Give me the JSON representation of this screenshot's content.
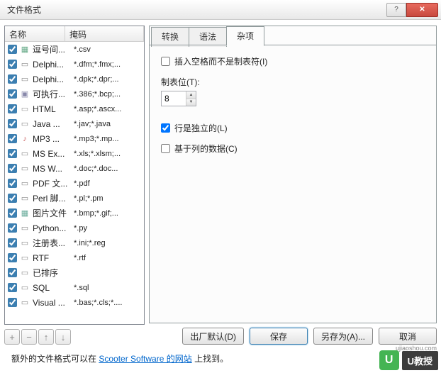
{
  "window": {
    "title": "文件格式"
  },
  "list": {
    "headers": {
      "name": "名称",
      "mask": "掩码"
    },
    "items": [
      {
        "checked": true,
        "icon": "csv",
        "name": "逗号间...",
        "mask": "*.csv"
      },
      {
        "checked": true,
        "icon": "doc",
        "name": "Delphi...",
        "mask": "*.dfm;*.fmx;..."
      },
      {
        "checked": true,
        "icon": "doc",
        "name": "Delphi...",
        "mask": "*.dpk;*.dpr;..."
      },
      {
        "checked": true,
        "icon": "exe",
        "name": "可执行...",
        "mask": "*.386;*.bcp;..."
      },
      {
        "checked": true,
        "icon": "html",
        "name": "HTML",
        "mask": "*.asp;*.ascx..."
      },
      {
        "checked": true,
        "icon": "doc",
        "name": "Java ...",
        "mask": "*.jav;*.java"
      },
      {
        "checked": true,
        "icon": "mp3",
        "name": "MP3 ...",
        "mask": "*.mp3;*.mp..."
      },
      {
        "checked": true,
        "icon": "doc",
        "name": "MS Ex...",
        "mask": "*.xls;*.xlsm;..."
      },
      {
        "checked": true,
        "icon": "doc",
        "name": "MS W...",
        "mask": "*.doc;*.doc..."
      },
      {
        "checked": true,
        "icon": "doc",
        "name": "PDF 文...",
        "mask": "*.pdf"
      },
      {
        "checked": true,
        "icon": "doc",
        "name": "Perl 脚...",
        "mask": "*.pl;*.pm"
      },
      {
        "checked": true,
        "icon": "img",
        "name": "图片文件",
        "mask": "*.bmp;*.gif;..."
      },
      {
        "checked": true,
        "icon": "doc",
        "name": "Python...",
        "mask": "*.py"
      },
      {
        "checked": true,
        "icon": "doc",
        "name": "注册表...",
        "mask": "*.ini;*.reg"
      },
      {
        "checked": true,
        "icon": "doc",
        "name": "RTF",
        "mask": "*.rtf"
      },
      {
        "checked": true,
        "icon": "doc",
        "name": "已排序",
        "mask": ""
      },
      {
        "checked": true,
        "icon": "doc",
        "name": "SQL",
        "mask": "*.sql"
      },
      {
        "checked": true,
        "icon": "doc",
        "name": "Visual ...",
        "mask": "*.bas;*.cls;*...."
      }
    ]
  },
  "toolbar": {
    "add": "+",
    "remove": "−",
    "up": "↑",
    "down": "↓"
  },
  "tabs": {
    "convert": "转换",
    "syntax": "语法",
    "misc": "杂项"
  },
  "misc": {
    "insert_spaces": "插入空格而不是制表符(I)",
    "tab_stop_label": "制表位(T):",
    "tab_stop_value": "8",
    "line_independent": "行是独立的(L)",
    "column_based": "基于列的数据(C)"
  },
  "buttons": {
    "defaults": "出厂默认(D)",
    "save": "保存",
    "saveas": "另存为(A)...",
    "cancel": "取消"
  },
  "footer": {
    "prefix": "额外的文件格式可以在 ",
    "link": "Scooter Software 的网站",
    "suffix": " 上找到。"
  },
  "watermark": {
    "badge": "U",
    "text": "U教授",
    "url": "ujiaoshou.com"
  }
}
